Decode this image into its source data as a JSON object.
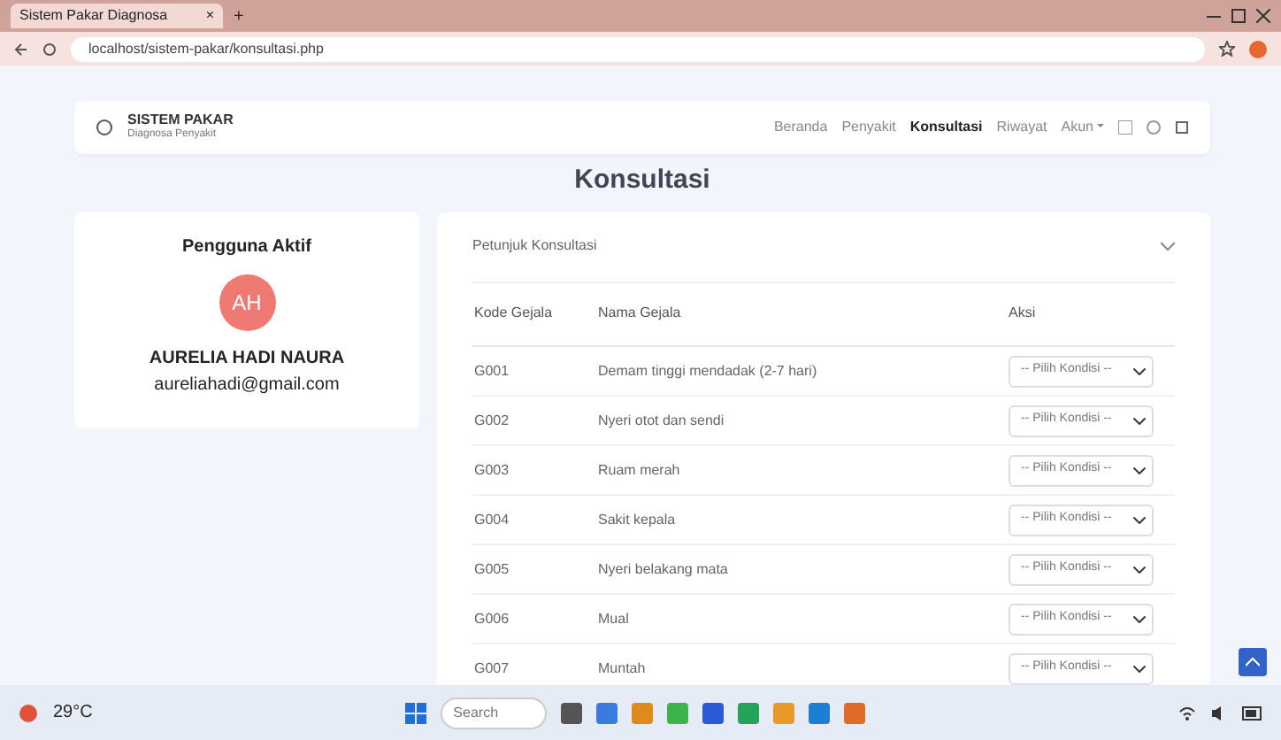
{
  "browser": {
    "tab_title": "Sistem Pakar Diagnosa",
    "close": "×",
    "new_tab": "+",
    "url": "localhost/sistem-pakar/konsultasi.php"
  },
  "navbar": {
    "brand": "SISTEM PAKAR",
    "subtitle": "Diagnosa Penyakit",
    "links": [
      {
        "label": "Beranda",
        "selected": false
      },
      {
        "label": "Penyakit",
        "selected": false
      },
      {
        "label": "Konsultasi",
        "selected": true
      },
      {
        "label": "Riwayat",
        "selected": false
      },
      {
        "label": "Akun",
        "selected": false,
        "kind": "dropdown"
      }
    ]
  },
  "page_title": "Konsultasi",
  "user_card": {
    "title": "Pengguna Aktif",
    "initials": "AH",
    "name": "AURELIA HADI NAURA",
    "email": "aureliahadi@gmail.com"
  },
  "consult_card": {
    "title": "Petunjuk Konsultasi",
    "expanded": false,
    "columns": [
      "Kode Gejala",
      "Nama Gejala",
      "Aksi"
    ],
    "rows": [
      {
        "code": "G001",
        "name": "Demam tinggi mendadak (2-7 hari)",
        "action": "-- Pilih Kondisi --"
      },
      {
        "code": "G002",
        "name": "Nyeri otot dan sendi",
        "action": "-- Pilih Kondisi --"
      },
      {
        "code": "G003",
        "name": "Ruam merah",
        "action": "-- Pilih Kondisi --"
      },
      {
        "code": "G004",
        "name": "Sakit kepala",
        "action": "-- Pilih Kondisi --"
      },
      {
        "code": "G005",
        "name": "Nyeri belakang mata",
        "action": "-- Pilih Kondisi --"
      },
      {
        "code": "G006",
        "name": "Mual",
        "action": "-- Pilih Kondisi --"
      },
      {
        "code": "G007",
        "name": "Muntah",
        "action": "-- Pilih Kondisi --"
      }
    ]
  },
  "taskbar": {
    "weather": "29°C",
    "search_placeholder": "Search"
  }
}
